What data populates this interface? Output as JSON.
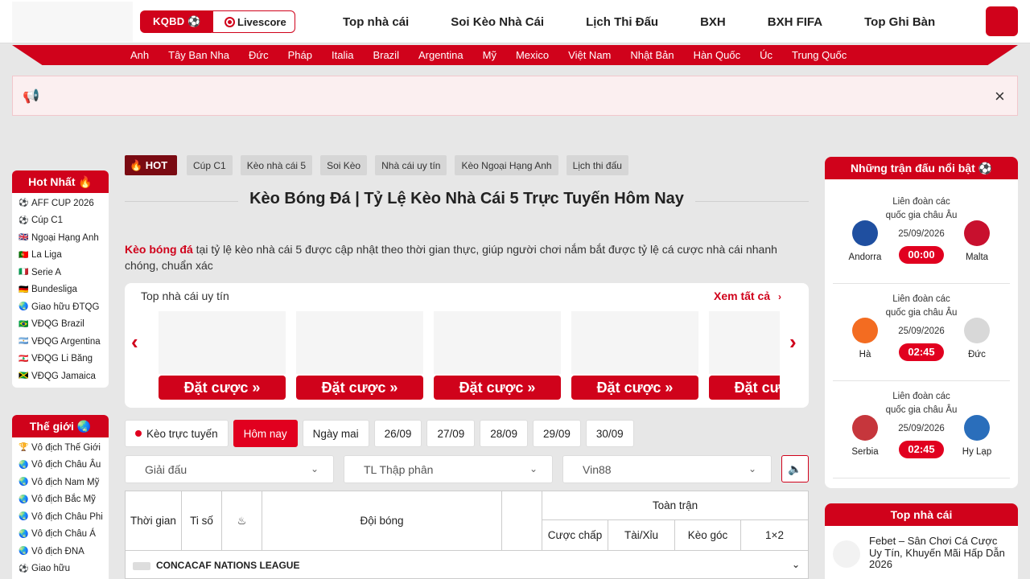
{
  "header": {
    "kqbd_label": "KQBD ⚽",
    "livescore_label": "Livescore",
    "nav": [
      "Top nhà cái",
      "Soi Kèo Nhà Cái",
      "Lịch Thi Đấu",
      "BXH",
      "BXH FIFA",
      "Top Ghi Bàn"
    ]
  },
  "countries": [
    "Anh",
    "Tây Ban Nha",
    "Đức",
    "Pháp",
    "Italia",
    "Brazil",
    "Argentina",
    "Mỹ",
    "Mexico",
    "Việt Nam",
    "Nhật Bản",
    "Hàn Quốc",
    "Úc",
    "Trung Quốc"
  ],
  "notice": {
    "close_icon": "×"
  },
  "hot_sidebar": {
    "title": "Hot Nhất 🔥",
    "items": [
      {
        "icon": "⚽",
        "label": "AFF CUP 2026"
      },
      {
        "icon": "⚽",
        "label": "Cúp C1"
      },
      {
        "icon": "🇬🇧",
        "label": "Ngoại Hạng Anh"
      },
      {
        "icon": "🇵🇹",
        "label": "La Liga"
      },
      {
        "icon": "🇮🇹",
        "label": "Serie A"
      },
      {
        "icon": "🇩🇪",
        "label": "Bundesliga"
      },
      {
        "icon": "🌏",
        "label": "Giao hữu ĐTQG"
      },
      {
        "icon": "🇧🇷",
        "label": "VĐQG Brazil"
      },
      {
        "icon": "🇦🇷",
        "label": "VĐQG Argentina"
      },
      {
        "icon": "🇱🇧",
        "label": "VĐQG Li Băng"
      },
      {
        "icon": "🇯🇲",
        "label": "VĐQG Jamaica"
      }
    ]
  },
  "world_sidebar": {
    "title": "Thế giới 🌏",
    "items": [
      {
        "icon": "🏆",
        "label": "Vô địch Thế Giới"
      },
      {
        "icon": "🌏",
        "label": "Vô địch Châu Âu"
      },
      {
        "icon": "🌏",
        "label": "Vô địch Nam Mỹ"
      },
      {
        "icon": "🌏",
        "label": "Vô địch Bắc Mỹ"
      },
      {
        "icon": "🌏",
        "label": "Vô địch Châu Phi"
      },
      {
        "icon": "🌏",
        "label": "Vô địch Châu Á"
      },
      {
        "icon": "🌏",
        "label": "Vô địch ĐNA"
      },
      {
        "icon": "⚽",
        "label": "Giao hữu"
      }
    ]
  },
  "tags": {
    "hot_label": "🔥 HOT",
    "items": [
      "Cúp C1",
      "Kèo nhà cái 5",
      "Soi Kèo",
      "Nhà cái uy tín",
      "Kèo Ngoại Hạng Anh",
      "Lịch thi đấu"
    ]
  },
  "main": {
    "title": "Kèo Bóng Đá | Tỷ Lệ Kèo Nhà Cái 5 Trực Tuyến Hôm Nay",
    "intro_bold": "Kèo bóng đá",
    "intro_rest": " tại tỷ lệ kèo nhà cái 5 được cập nhật theo thời gian thực, giúp người chơi nắm bắt được tỷ lệ cá cược nhà cái nhanh chóng, chuẩn xác"
  },
  "bookies": {
    "title": "Top nhà cái uy tín",
    "see_all": "Xem tất cả",
    "bet_label": "Đặt cược »"
  },
  "days": {
    "live": "Kèo trực tuyến",
    "items": [
      "Hôm nay",
      "Ngày mai",
      "26/09",
      "27/09",
      "28/09",
      "29/09",
      "30/09"
    ],
    "active": "Hôm nay"
  },
  "filters": {
    "league_placeholder": "Giải đấu",
    "odds_format": "TL Thập phân",
    "bookmaker": "Vin88"
  },
  "table": {
    "col_time": "Thời gian",
    "col_score": "Ti số",
    "col_team": "Đội bóng",
    "col_full": "Toàn trận",
    "col_handicap": "Cược chấp",
    "col_ou": "Tài/Xỉu",
    "col_corner": "Kèo góc",
    "col_1x2": "1×2",
    "league": "CONCACAF NATIONS LEAGUE"
  },
  "featured": {
    "title": "Những trận đấu nổi bật ⚽",
    "matches": [
      {
        "home": "Andorra",
        "away": "Malta",
        "comp": "Liên đoàn các quốc gia châu Âu",
        "date": "25/09/2026",
        "time": "00:00",
        "home_color": "#1f4fa0",
        "away_color": "#c8102e"
      },
      {
        "home": "Hà",
        "away": "Đức",
        "comp": "Liên đoàn các quốc gia châu Âu",
        "date": "25/09/2026",
        "time": "02:45",
        "home_color": "#f36c21",
        "away_color": "#d8d8d8"
      },
      {
        "home": "Serbia",
        "away": "Hy Lạp",
        "comp": "Liên đoàn các quốc gia châu Âu",
        "date": "25/09/2026",
        "time": "02:45",
        "home_color": "#c6363c",
        "away_color": "#2a6ebb"
      }
    ]
  },
  "top_bookies": {
    "title": "Top nhà cái",
    "first": "Febet – Sân Chơi Cá Cược Uy Tín, Khuyến Mãi Hấp Dẫn 2026"
  },
  "colors": {
    "accent": "#d0021b",
    "active": "#e1001f"
  }
}
